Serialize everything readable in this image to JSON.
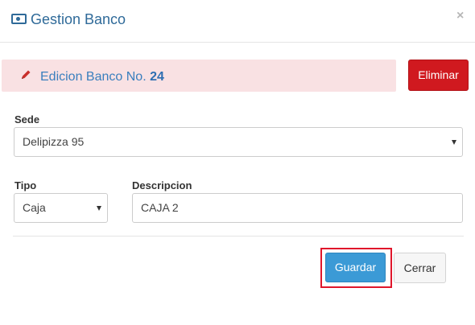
{
  "header": {
    "title": "Gestion Banco",
    "icon": "money-bill-icon",
    "close_label": "×"
  },
  "alert": {
    "icon": "pencil-icon",
    "text": "Edicion Banco No. ",
    "number": "24"
  },
  "actions_top": {
    "delete_label": "Eliminar"
  },
  "form": {
    "sede": {
      "label": "Sede",
      "value": "Delipizza 95"
    },
    "tipo": {
      "label": "Tipo",
      "value": "Caja"
    },
    "descripcion": {
      "label": "Descripcion",
      "value": "CAJA 2"
    }
  },
  "footer": {
    "save_label": "Guardar",
    "close_label": "Cerrar"
  },
  "colors": {
    "title": "#2f6a99",
    "alert_bg": "#f9e1e3",
    "delete_button": "#d0191f",
    "save_button": "#3b9ad6",
    "highlight_border": "#e0162b"
  }
}
